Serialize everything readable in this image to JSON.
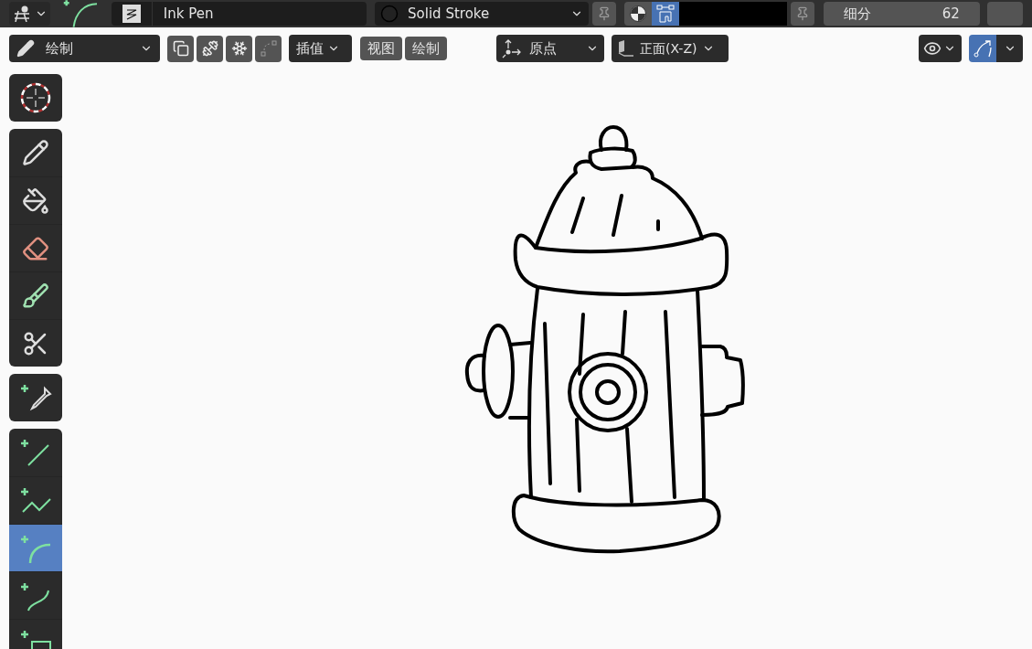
{
  "header": {
    "brush_name": "Ink Pen",
    "material": "Solid Stroke",
    "toggles": [
      {
        "kind": "shading",
        "selected": false
      },
      {
        "kind": "stroke",
        "selected": true
      }
    ],
    "subdivision_label": "细分",
    "subdivision_value": "62"
  },
  "toolbar_row": {
    "mode": "绘制",
    "interpolate": "插值",
    "menus": [
      "视图",
      "绘制"
    ],
    "pivot": "原点",
    "orientation": "正面(X-Z)",
    "guides": {
      "selected": true
    }
  },
  "tool_groups": [
    [
      {
        "kind": "cursor",
        "selected": false
      }
    ],
    [
      {
        "kind": "draw",
        "selected": false
      },
      {
        "kind": "fill",
        "selected": false
      },
      {
        "kind": "erase",
        "selected": false
      },
      {
        "kind": "tint",
        "selected": false
      },
      {
        "kind": "cutter",
        "selected": false
      }
    ],
    [
      {
        "kind": "eyedropper",
        "selected": false
      }
    ],
    [
      {
        "kind": "line",
        "selected": false
      },
      {
        "kind": "polyline",
        "selected": false
      },
      {
        "kind": "arc",
        "selected": true
      },
      {
        "kind": "curve",
        "selected": false
      },
      {
        "kind": "box",
        "selected": false
      }
    ]
  ]
}
